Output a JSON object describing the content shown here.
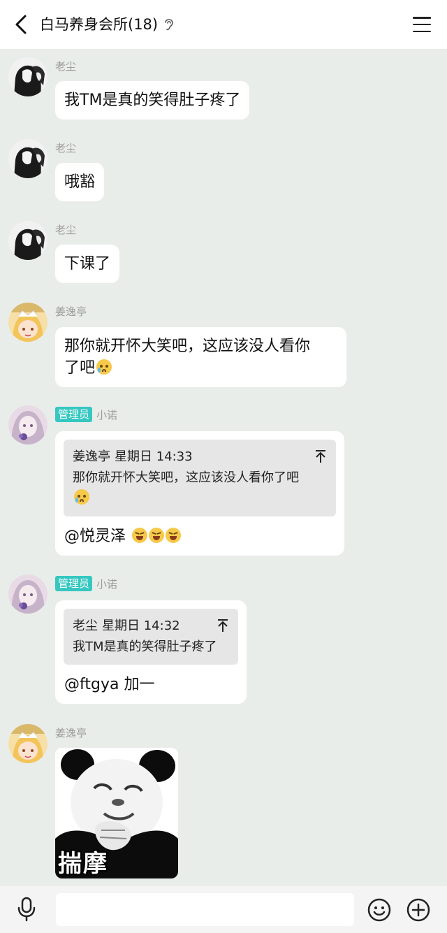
{
  "header": {
    "title": "白马养身会所(18)"
  },
  "messages": [
    {
      "sender": "老尘",
      "text": "我TM是真的笑得肚子疼了"
    },
    {
      "sender": "老尘",
      "text": "哦豁"
    },
    {
      "sender": "老尘",
      "text": "下课了"
    },
    {
      "sender": "姜逸亭",
      "text_line1": "那你就开怀大笑吧，这应该没人看你",
      "text_line2": "了吧"
    },
    {
      "badge": "管理员",
      "sender": "小诺",
      "quote": {
        "name": "姜逸亭",
        "time": "星期日 14:33",
        "line1": "那你就开怀大笑吧，这应该没人看你了吧"
      },
      "reply": "@悦灵泽"
    },
    {
      "badge": "管理员",
      "sender": "小诺",
      "quote": {
        "name": "老尘",
        "time": "星期日 14:32",
        "line1": "我TM是真的笑得肚子疼了"
      },
      "reply": "@ftgya 加一"
    },
    {
      "sender": "姜逸亭",
      "sticker_text": "揣摩"
    }
  ],
  "input": {
    "placeholder": ""
  },
  "colors": {
    "admin_badge": "#35c7c0",
    "chat_bg": "#e9edea",
    "bubble_bg": "#ffffff"
  },
  "icons": [
    "back-arrow-icon",
    "ear-icon",
    "menu-icon",
    "microphone-icon",
    "smiley-icon",
    "plus-circle-icon"
  ]
}
